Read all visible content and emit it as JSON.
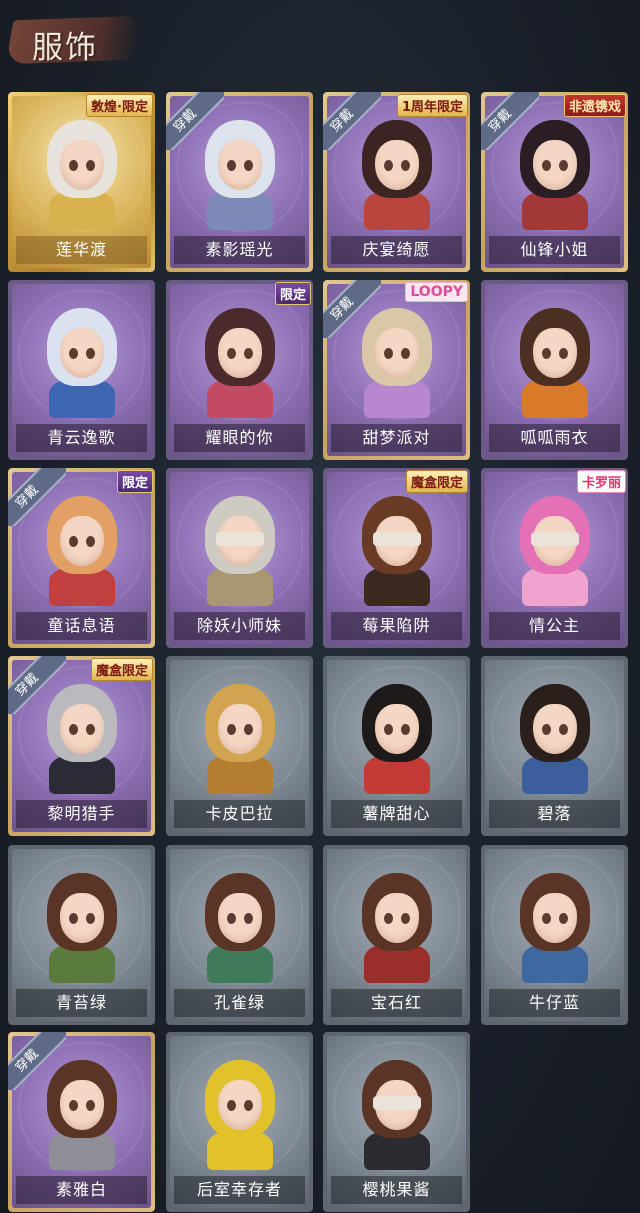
{
  "header": {
    "title": "服饰"
  },
  "worn_label": "穿戴",
  "cards": [
    {
      "name": "莲华渡",
      "rarity": "gold",
      "tag": "敦煌·限定",
      "tag_style": "gold",
      "worn": false,
      "hair": "#e7e2dc",
      "outfit": "#d8b24f"
    },
    {
      "name": "素影瑶光",
      "rarity": "purple",
      "tag": "",
      "worn": true,
      "hair": "#dde3ec",
      "outfit": "#7d8ab8"
    },
    {
      "name": "庆宴绮愿",
      "rarity": "purple",
      "tag": "1周年限定",
      "tag_style": "gold",
      "worn": true,
      "hair": "#3b2421",
      "outfit": "#b8463d"
    },
    {
      "name": "仙锋小姐",
      "rarity": "purple",
      "tag": "非遗镌戏",
      "tag_style": "red",
      "worn": true,
      "hair": "#2a1e24",
      "outfit": "#a23838"
    },
    {
      "name": "青云逸歌",
      "rarity": "plainpurple",
      "tag": "",
      "worn": false,
      "hair": "#d9e2ee",
      "outfit": "#3d67b2"
    },
    {
      "name": "耀眼的你",
      "rarity": "plainpurple",
      "tag": "限定",
      "tag_style": "purple",
      "worn": false,
      "hair": "#4a2a2a",
      "outfit": "#c24a62"
    },
    {
      "name": "甜梦派对",
      "rarity": "purple",
      "tag": "LOOPY",
      "tag_style": "loopy",
      "worn": true,
      "hair": "#d9c7a8",
      "outfit": "#b787cf"
    },
    {
      "name": "呱呱雨衣",
      "rarity": "plainpurple",
      "tag": "",
      "worn": false,
      "hair": "#4b2f22",
      "outfit": "#d97a2a"
    },
    {
      "name": "童话息语",
      "rarity": "purple",
      "tag": "限定",
      "tag_style": "purple",
      "worn": true,
      "hair": "#e3a065",
      "outfit": "#c34040"
    },
    {
      "name": "除妖小师妹",
      "rarity": "plainpurple",
      "tag": "",
      "worn": false,
      "hair": "#cfcbc2",
      "outfit": "#a99770"
    },
    {
      "name": "莓果陷阱",
      "rarity": "plainpurple",
      "tag": "魔盒限定",
      "tag_style": "gold",
      "worn": false,
      "hair": "#6a3b24",
      "outfit": "#3b2a22"
    },
    {
      "name": "情公主",
      "rarity": "plainpurple",
      "tag": "卡罗丽",
      "tag_style": "pink",
      "worn": false,
      "hair": "#e470b5",
      "outfit": "#f0a3cf"
    },
    {
      "name": "黎明猎手",
      "rarity": "purple",
      "tag": "魔盒限定",
      "tag_style": "gold",
      "worn": true,
      "hair": "#b9b9be",
      "outfit": "#2a2b36"
    },
    {
      "name": "卡皮巴拉",
      "rarity": "grey",
      "tag": "",
      "worn": false,
      "hair": "#d3a44f",
      "outfit": "#b57d2f"
    },
    {
      "name": "薯牌甜心",
      "rarity": "grey",
      "tag": "",
      "worn": false,
      "hair": "#1f1a1a",
      "outfit": "#c23b36"
    },
    {
      "name": "碧落",
      "rarity": "grey",
      "tag": "",
      "worn": false,
      "hair": "#2a1f1b",
      "outfit": "#3b5f9c"
    },
    {
      "name": "青苔绿",
      "rarity": "grey",
      "tag": "",
      "worn": false,
      "hair": "#5a3526",
      "outfit": "#5b7a3d"
    },
    {
      "name": "孔雀绿",
      "rarity": "grey",
      "tag": "",
      "worn": false,
      "hair": "#5a3526",
      "outfit": "#3f7b5a"
    },
    {
      "name": "宝石红",
      "rarity": "grey",
      "tag": "",
      "worn": false,
      "hair": "#5a3526",
      "outfit": "#9a2e2a"
    },
    {
      "name": "牛仔蓝",
      "rarity": "grey",
      "tag": "",
      "worn": false,
      "hair": "#5a3526",
      "outfit": "#3f67a0"
    },
    {
      "name": "素雅白",
      "rarity": "purple",
      "tag": "",
      "worn": true,
      "hair": "#5a3526",
      "outfit": "#8e8e96"
    },
    {
      "name": "后室幸存者",
      "rarity": "grey",
      "tag": "",
      "worn": false,
      "hair": "#e2c22a",
      "outfit": "#e2c22a"
    },
    {
      "name": "樱桃果酱",
      "rarity": "grey",
      "tag": "",
      "worn": false,
      "hair": "#5a3526",
      "outfit": "#2a2a30",
      "blindfold": true
    }
  ]
}
